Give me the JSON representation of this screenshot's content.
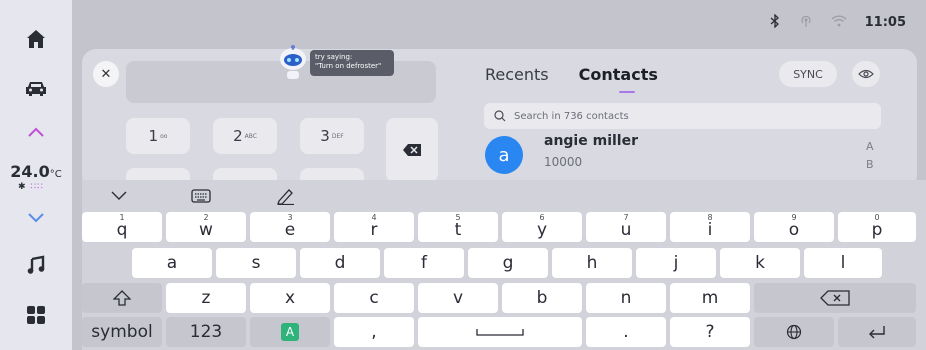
{
  "status": {
    "time": "11:05"
  },
  "sidebar": {
    "temperature": "24.0",
    "temp_unit": "°C"
  },
  "assistant": {
    "bubble_line1": "try saying:",
    "bubble_line2": "\"Turn on defroster\""
  },
  "dialpad": {
    "keys": [
      {
        "num": "1",
        "letters": "ᴏᴏ"
      },
      {
        "num": "2",
        "letters": "ABC"
      },
      {
        "num": "3",
        "letters": "DEF"
      }
    ]
  },
  "contacts": {
    "tabs": [
      "Recents",
      "Contacts"
    ],
    "active_tab": "Contacts",
    "sync_label": "SYNC",
    "search_placeholder": "Search in 736 contacts",
    "list": [
      {
        "initial": "a",
        "name": "angie miller",
        "number": "10000"
      }
    ],
    "index": [
      "A",
      "B"
    ]
  },
  "keyboard": {
    "row1": [
      {
        "hint": "1",
        "key": "q"
      },
      {
        "hint": "2",
        "key": "w"
      },
      {
        "hint": "3",
        "key": "e"
      },
      {
        "hint": "4",
        "key": "r"
      },
      {
        "hint": "5",
        "key": "t"
      },
      {
        "hint": "6",
        "key": "y"
      },
      {
        "hint": "7",
        "key": "u"
      },
      {
        "hint": "8",
        "key": "i"
      },
      {
        "hint": "9",
        "key": "o"
      },
      {
        "hint": "0",
        "key": "p"
      }
    ],
    "row2": [
      "a",
      "s",
      "d",
      "f",
      "g",
      "h",
      "j",
      "k",
      "l"
    ],
    "row3": [
      "z",
      "x",
      "c",
      "v",
      "b",
      "n",
      "m"
    ],
    "row4": {
      "symbol": "symbol",
      "num": "123",
      "lang_badge": "A",
      "comma": ",",
      "period": ".",
      "question": "?"
    }
  },
  "colors": {
    "accent": "#2a86f0",
    "tab_underline": "#a678e8",
    "lang_badge": "#2fb37a"
  }
}
